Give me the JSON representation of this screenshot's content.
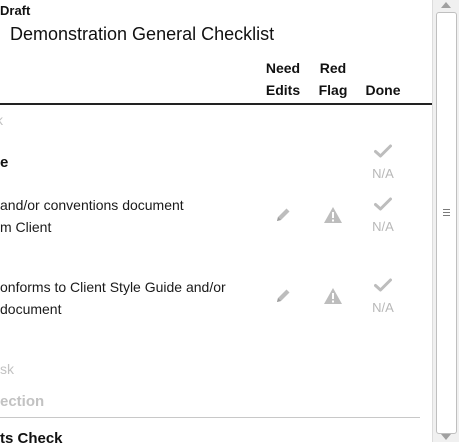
{
  "header": {
    "status": "Draft",
    "title": "Demonstration General Checklist"
  },
  "columns": {
    "need_edits": [
      "Need",
      "Edits"
    ],
    "red_flag": [
      "Red",
      "Flag"
    ],
    "done": "Done"
  },
  "section": {
    "partial_top": "k",
    "title_fragment": "e"
  },
  "items": [
    {
      "line1": "and/or conventions document",
      "line2": "m Client",
      "done_status": "N/A"
    },
    {
      "line1": "onforms to Client Style Guide and/or",
      "line2": " document",
      "done_status": "N/A"
    }
  ],
  "first_row_done_status": "N/A",
  "add_task_fragment": "sk",
  "add_section_fragment": "ection",
  "next_section_fragment": "ts Check",
  "icons": {
    "edit": "pencil-icon",
    "flag": "warning-icon",
    "done": "checkmark-icon"
  },
  "colors": {
    "icon_gray": "#bdbdbd",
    "muted_text": "#c2c2c2",
    "rule": "#222222"
  }
}
